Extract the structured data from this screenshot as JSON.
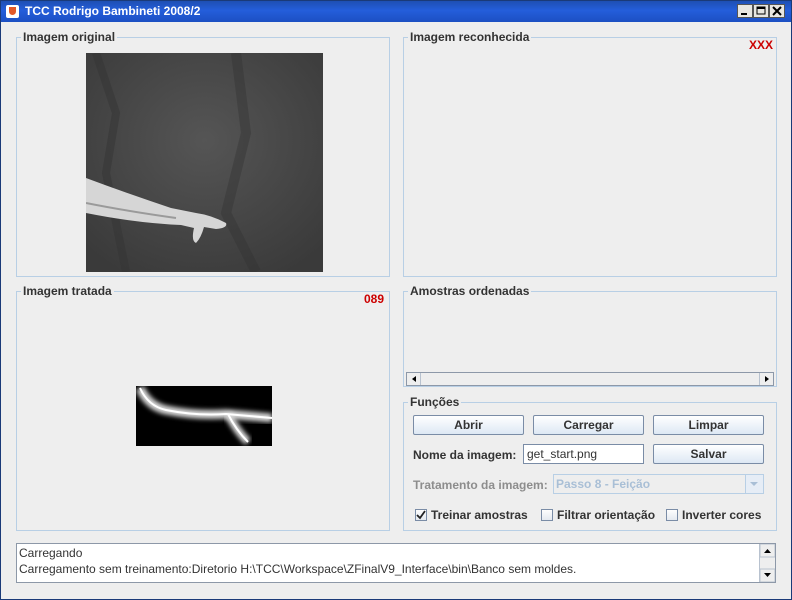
{
  "window": {
    "title": "TCC Rodrigo Bambineti 2008/2"
  },
  "panels": {
    "original": {
      "title": "Imagem original"
    },
    "recognized": {
      "title": "Imagem reconhecida",
      "code": "XXX"
    },
    "treated": {
      "title": "Imagem tratada",
      "code": "089"
    },
    "samples": {
      "title": "Amostras ordenadas"
    },
    "functions": {
      "title": "Funções"
    }
  },
  "functions": {
    "open_label": "Abrir",
    "load_label": "Carregar",
    "clear_label": "Limpar",
    "image_name_label": "Nome da imagem:",
    "image_name_value": "get_start.png",
    "save_label": "Salvar",
    "treatment_label": "Tratamento da imagem:",
    "treatment_value": "Passo 8 - Feição",
    "train_label": "Treinar amostras",
    "train_checked": true,
    "filter_label": "Filtrar orientação",
    "filter_checked": false,
    "invert_label": "Inverter cores",
    "invert_checked": false
  },
  "console": {
    "lines": [
      "Carregando",
      "Carregamento sem treinamento:Diretorio H:\\TCC\\Workspace\\ZFinalV9_Interface\\bin\\Banco sem moldes."
    ]
  },
  "colors": {
    "accent": "#cc0000",
    "titlebar": "#245edb",
    "panel_border": "#b8cfe5"
  }
}
